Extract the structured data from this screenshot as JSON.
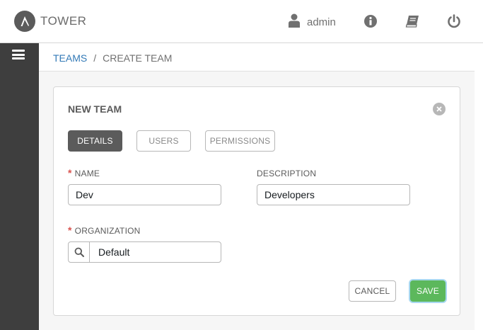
{
  "app": {
    "brand": "TOWER",
    "user": "admin"
  },
  "header": {
    "icons": [
      "user-icon",
      "info-icon",
      "book-icon",
      "power-icon"
    ]
  },
  "breadcrumb": {
    "teams": "TEAMS",
    "separator": "/",
    "current": "CREATE TEAM"
  },
  "panel": {
    "title": "NEW TEAM",
    "tabs": [
      {
        "label": "DETAILS",
        "active": true
      },
      {
        "label": "USERS",
        "active": false
      },
      {
        "label": "PERMISSIONS",
        "active": false
      }
    ]
  },
  "form": {
    "name": {
      "label": "NAME",
      "required": "*",
      "value": "Dev"
    },
    "description": {
      "label": "DESCRIPTION",
      "value": "Developers"
    },
    "organization": {
      "label": "ORGANIZATION",
      "required": "*",
      "value": "Default"
    }
  },
  "actions": {
    "cancel": "CANCEL",
    "save": "SAVE"
  },
  "colors": {
    "sidebar": "#3e3e3e",
    "link": "#337ab7",
    "save": "#5cb85c",
    "required": "#d9534f",
    "active_tab": "#5b5b5b"
  }
}
